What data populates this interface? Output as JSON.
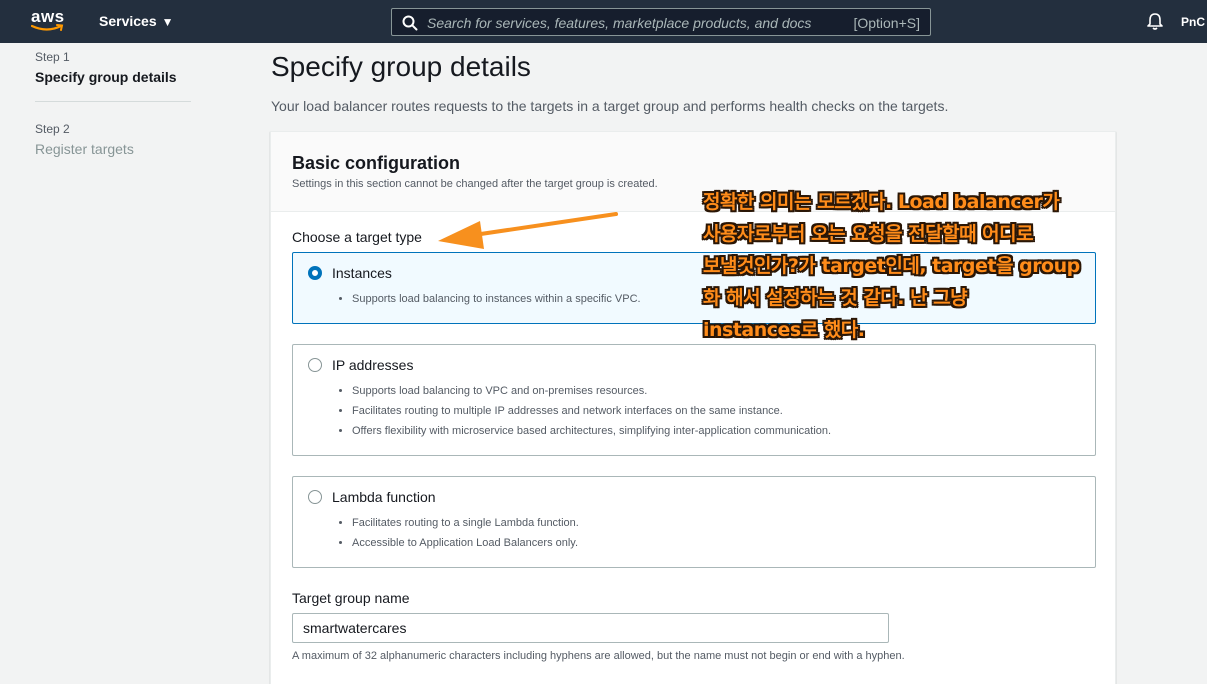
{
  "topnav": {
    "logo_text": "aws",
    "services_label": "Services",
    "search_placeholder": "Search for services, features, marketplace products, and docs",
    "search_shortcut": "[Option+S]",
    "account_label": "PnC",
    "icons": [
      "caret-down-icon",
      "search-icon",
      "bell-icon"
    ]
  },
  "steps": [
    {
      "label": "Step 1",
      "title": "Specify group details"
    },
    {
      "label": "Step 2",
      "title": "Register targets"
    }
  ],
  "page": {
    "title": "Specify group details",
    "description": "Your load balancer routes requests to the targets in a target group and performs health checks on the targets."
  },
  "basic_config": {
    "title": "Basic configuration",
    "description": "Settings in this section cannot be changed after the target group is created.",
    "target_type_label": "Choose a target type",
    "options": [
      {
        "title": "Instances",
        "selected": true,
        "bullets": [
          "Supports load balancing to instances within a specific VPC."
        ]
      },
      {
        "title": "IP addresses",
        "selected": false,
        "bullets": [
          "Supports load balancing to VPC and on-premises resources.",
          "Facilitates routing to multiple IP addresses and network interfaces on the same instance.",
          "Offers flexibility with microservice based architectures, simplifying inter-application communication."
        ]
      },
      {
        "title": "Lambda function",
        "selected": false,
        "bullets": [
          "Facilitates routing to a single Lambda function.",
          "Accessible to Application Load Balancers only."
        ]
      }
    ],
    "name_label": "Target group name",
    "name_value": "smartwatercares",
    "name_hint": "A maximum of 32 alphanumeric characters including hyphens are allowed, but the name must not begin or end with a hyphen."
  },
  "annotation": {
    "lines": [
      "정확한 의미는 모르겠다. Load balancer가",
      "사용자로부터 오는 요청을 전달할때 어디로",
      "보낼것인가?가 target인데, target을 group",
      "화 해서 설정하는 것 같다. 난 그냥",
      "instances로 했다."
    ],
    "color": "#ff8c1a"
  },
  "colors": {
    "nav_bg": "#232f3e",
    "accent": "#0073bb",
    "aws_orange": "#ff9900"
  }
}
